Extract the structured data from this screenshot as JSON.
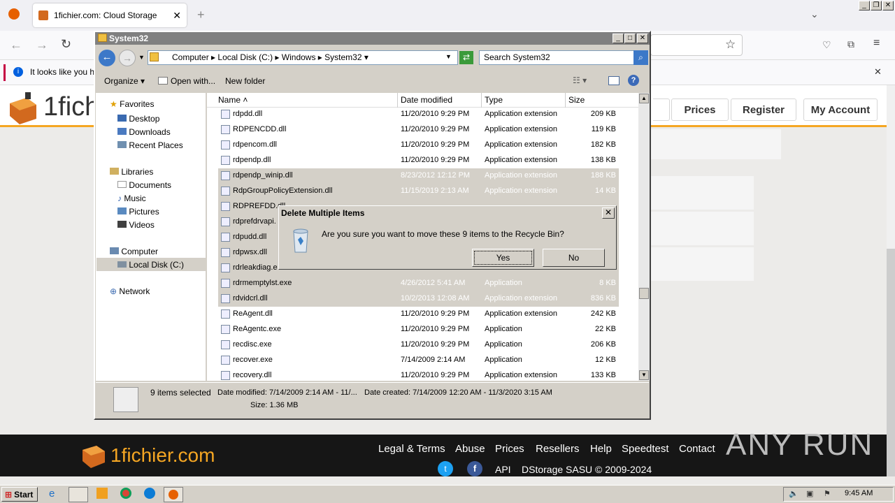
{
  "browser": {
    "tab_title": "1fichier.com: Cloud Storage",
    "notification_text": "It looks like you ha"
  },
  "site": {
    "logo_text": "1fich",
    "header_buttons": [
      "Prices",
      "Register",
      "My Account"
    ],
    "footer_logo": "1fichier.com",
    "footer_links": [
      "Legal & Terms",
      "Abuse",
      "Prices",
      "Resellers",
      "Help",
      "Speedtest",
      "Contact"
    ],
    "footer_bottom": [
      "API",
      "DStorage SASU © 2009-2024"
    ],
    "watermark": "ANY RUN"
  },
  "explorer": {
    "title": "System32",
    "breadcrumb": [
      "Computer",
      "Local Disk (C:)",
      "Windows",
      "System32"
    ],
    "search_placeholder": "Search System32",
    "toolbar": {
      "organize": "Organize",
      "open_with": "Open with...",
      "new_folder": "New folder"
    },
    "nav": {
      "favorites": "Favorites",
      "favorites_items": [
        "Desktop",
        "Downloads",
        "Recent Places"
      ],
      "libraries": "Libraries",
      "libraries_items": [
        "Documents",
        "Music",
        "Pictures",
        "Videos"
      ],
      "computer": "Computer",
      "computer_items": [
        "Local Disk (C:)"
      ],
      "network": "Network"
    },
    "columns": [
      "Name",
      "Date modified",
      "Type",
      "Size"
    ],
    "files": [
      {
        "name": "rdpdd.dll",
        "date": "11/20/2010 9:29 PM",
        "type": "Application extension",
        "size": "209 KB",
        "selected": false
      },
      {
        "name": "RDPENCDD.dll",
        "date": "11/20/2010 9:29 PM",
        "type": "Application extension",
        "size": "119 KB",
        "selected": false
      },
      {
        "name": "rdpencom.dll",
        "date": "11/20/2010 9:29 PM",
        "type": "Application extension",
        "size": "182 KB",
        "selected": false
      },
      {
        "name": "rdpendp.dll",
        "date": "11/20/2010 9:29 PM",
        "type": "Application extension",
        "size": "138 KB",
        "selected": false
      },
      {
        "name": "rdpendp_winip.dll",
        "date": "8/23/2012 12:12 PM",
        "type": "Application extension",
        "size": "188 KB",
        "selected": true
      },
      {
        "name": "RdpGroupPolicyExtension.dll",
        "date": "11/15/2019 2:13 AM",
        "type": "Application extension",
        "size": "14 KB",
        "selected": true
      },
      {
        "name": "RDPREFDD.dll",
        "date": "",
        "type": "",
        "size": "",
        "selected": true
      },
      {
        "name": "rdprefdrvapi.",
        "date": "",
        "type": "",
        "size": "",
        "selected": true
      },
      {
        "name": "rdpudd.dll",
        "date": "",
        "type": "",
        "size": "",
        "selected": true
      },
      {
        "name": "rdpwsx.dll",
        "date": "",
        "type": "",
        "size": "",
        "selected": true
      },
      {
        "name": "rdrleakdiag.e",
        "date": "",
        "type": "",
        "size": "",
        "selected": true
      },
      {
        "name": "rdrmemptylst.exe",
        "date": "4/26/2012 5:41 AM",
        "type": "Application",
        "size": "8 KB",
        "selected": true
      },
      {
        "name": "rdvidcrl.dll",
        "date": "10/2/2013 12:08 AM",
        "type": "Application extension",
        "size": "836 KB",
        "selected": true
      },
      {
        "name": "ReAgent.dll",
        "date": "11/20/2010 9:29 PM",
        "type": "Application extension",
        "size": "242 KB",
        "selected": false
      },
      {
        "name": "ReAgentc.exe",
        "date": "11/20/2010 9:29 PM",
        "type": "Application",
        "size": "22 KB",
        "selected": false
      },
      {
        "name": "recdisc.exe",
        "date": "11/20/2010 9:29 PM",
        "type": "Application",
        "size": "206 KB",
        "selected": false
      },
      {
        "name": "recover.exe",
        "date": "7/14/2009 2:14 AM",
        "type": "Application",
        "size": "12 KB",
        "selected": false
      },
      {
        "name": "recovery.dll",
        "date": "11/20/2010 9:29 PM",
        "type": "Application extension",
        "size": "133 KB",
        "selected": false
      }
    ],
    "details": {
      "count": "9 items selected",
      "modified": "Date modified: 7/14/2009 2:14 AM - 11/...",
      "created": "Date created: 7/14/2009 12:20 AM - 11/3/2020 3:15 AM",
      "size": "Size: 1.36 MB"
    }
  },
  "dialog": {
    "title": "Delete Multiple Items",
    "message": "Are you sure you want to move these 9 items to the Recycle Bin?",
    "yes": "Yes",
    "no": "No"
  },
  "taskbar": {
    "start": "Start",
    "clock": "9:45 AM"
  }
}
